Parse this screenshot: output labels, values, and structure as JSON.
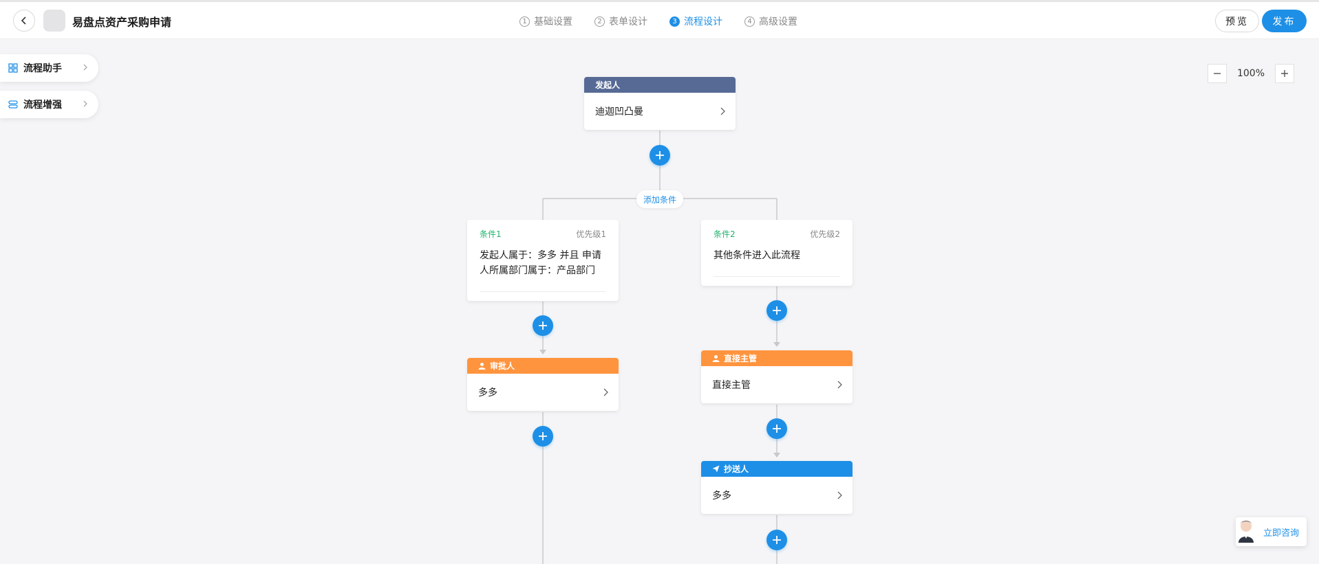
{
  "header": {
    "title": "易盘点资产采购申请",
    "steps": [
      {
        "num": "1",
        "label": "基础设置"
      },
      {
        "num": "2",
        "label": "表单设计"
      },
      {
        "num": "3",
        "label": "流程设计"
      },
      {
        "num": "4",
        "label": "高级设置"
      }
    ],
    "active_step": 3,
    "preview_label": "预览",
    "publish_label": "发布"
  },
  "sidebar": {
    "assistant_label": "流程助手",
    "enhance_label": "流程增强"
  },
  "zoom": {
    "value": "100%"
  },
  "flow": {
    "initiator": {
      "header": "发起人",
      "value": "迪迦凹凸曼"
    },
    "add_condition_label": "添加条件",
    "conditions": [
      {
        "name": "条件1",
        "priority": "优先级1",
        "desc": "发起人属于：多多 并且 申请人所属部门属于：产品部门"
      },
      {
        "name": "条件2",
        "priority": "优先级2",
        "desc": "其他条件进入此流程"
      }
    ],
    "approver": {
      "header": "审批人",
      "value": "多多"
    },
    "supervisor": {
      "header": "直接主管",
      "value": "直接主管"
    },
    "cc": {
      "header": "抄送人",
      "value": "多多"
    }
  },
  "consult": {
    "label": "立即咨询"
  },
  "colors": {
    "primary": "#1e8fe6",
    "initiator_header": "#576a95",
    "approver_header": "#ff943e",
    "cc_header": "#1e8fe6",
    "condition_name": "#1fb36b"
  }
}
